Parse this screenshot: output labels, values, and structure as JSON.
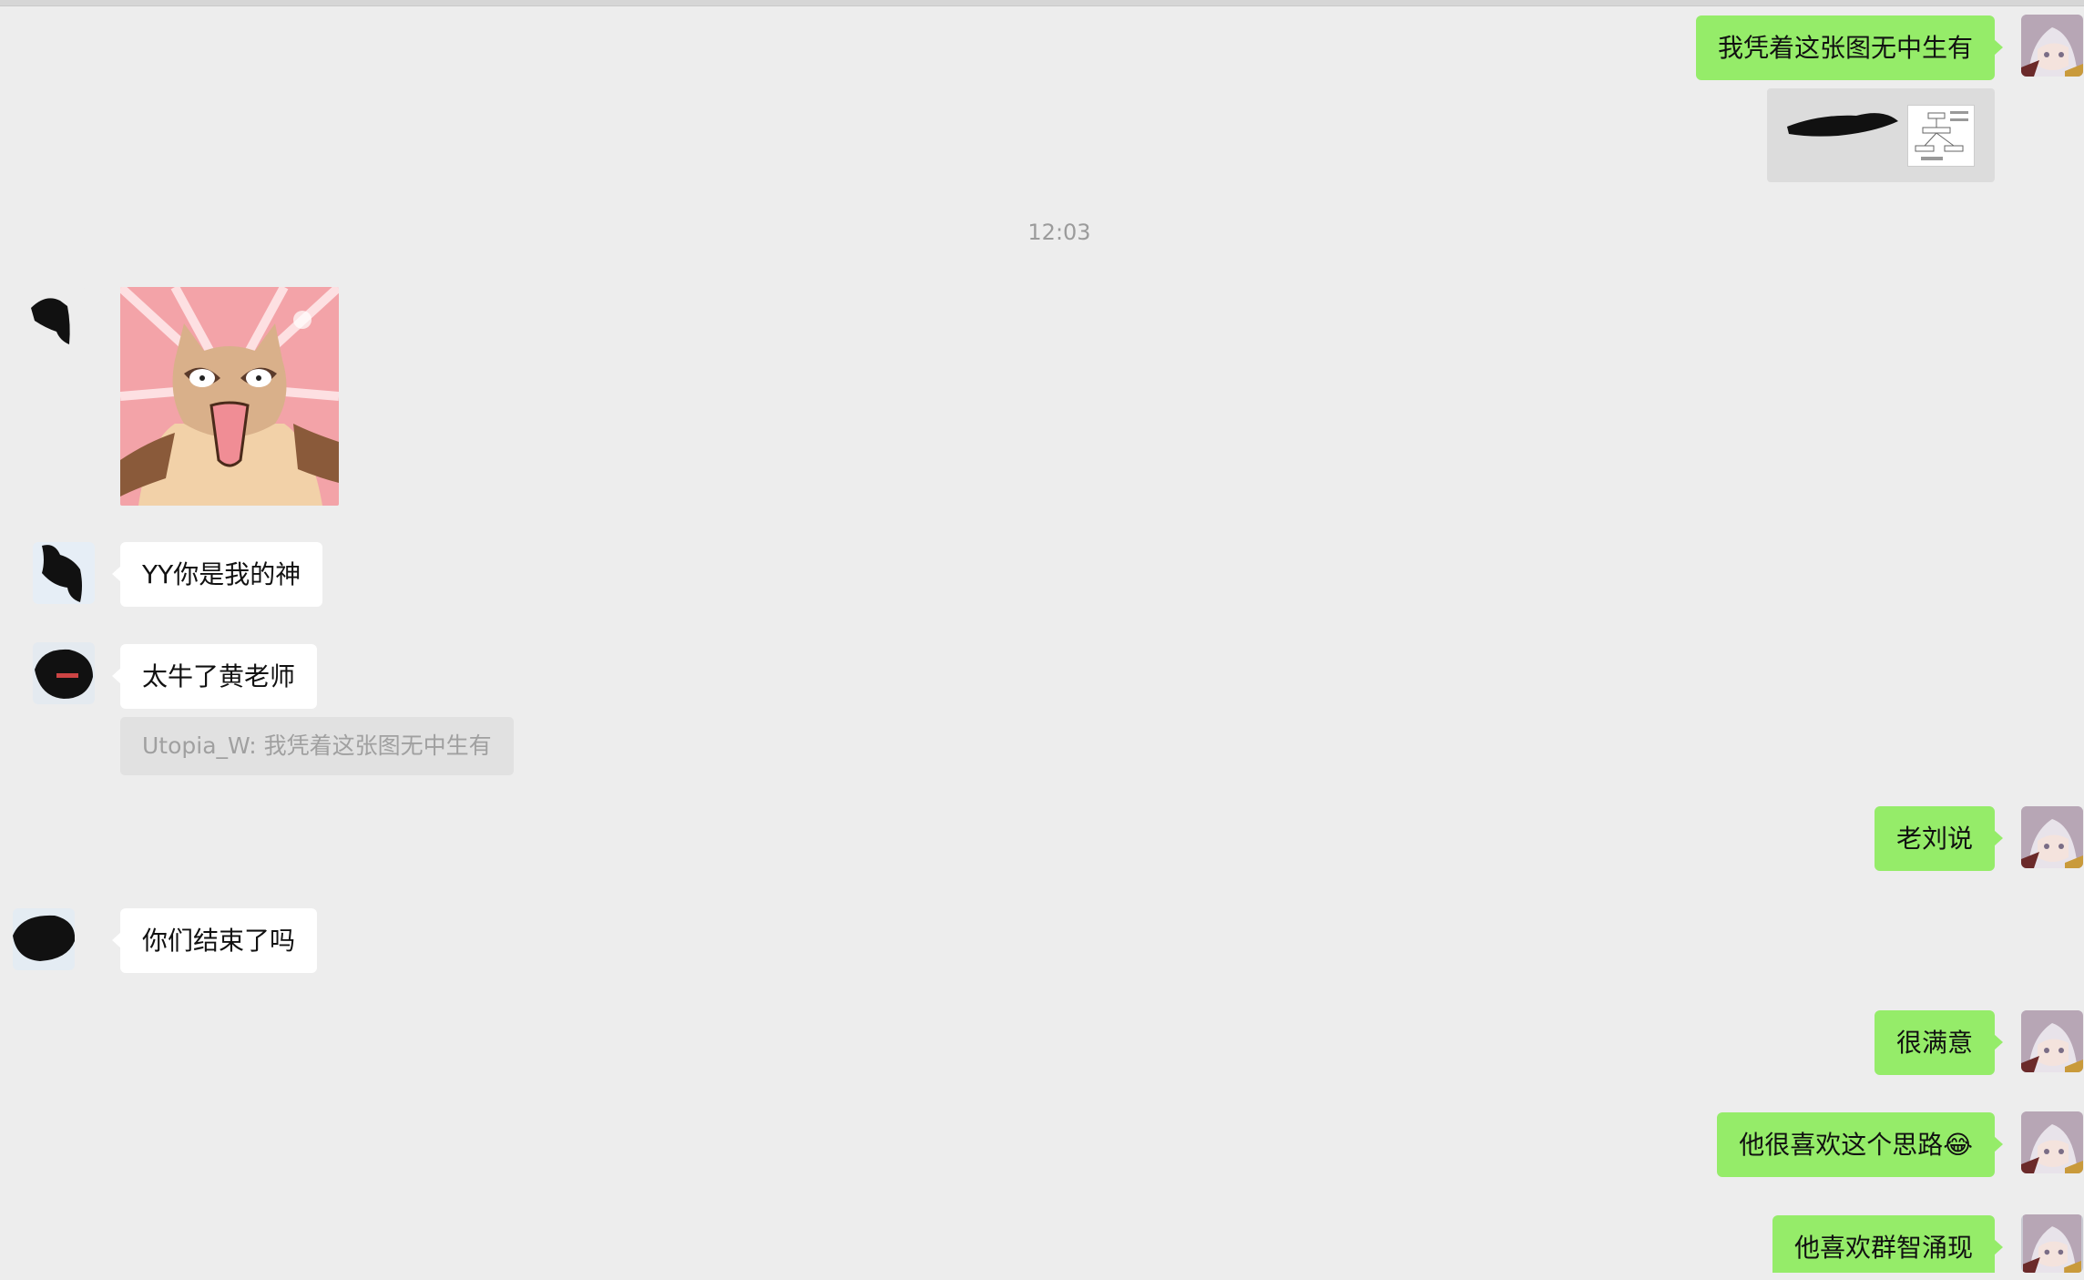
{
  "timestamp": "12:03",
  "messages": {
    "me1": "我凭着这张图无中生有",
    "other_yy": "YY你是我的神",
    "other_niu": "太牛了黄老师",
    "quote": "Utopia_W: 我凭着这张图无中生有",
    "me2": "老刘说",
    "other_end": "你们结束了吗",
    "me3": "很满意",
    "me4": "他很喜欢这个思路😂",
    "me5": "他喜欢群智涌现"
  },
  "colors": {
    "background": "#ededed",
    "my_bubble": "#95ec69",
    "other_bubble": "#ffffff",
    "quote_bg": "#e1e1e1"
  },
  "icons": {
    "sticker": "cat-surprised-sticker",
    "file_thumb": "diagram-thumbnail"
  }
}
